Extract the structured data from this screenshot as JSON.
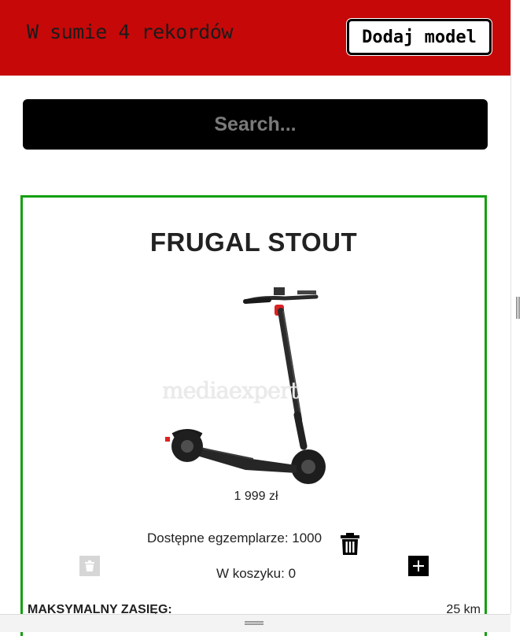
{
  "header": {
    "title": "W sumie 4 rekordów",
    "add_button_label": "Dodaj model"
  },
  "search": {
    "placeholder": "Search..."
  },
  "product": {
    "name": "FRUGAL STOUT",
    "watermark": "mediaexpert",
    "price": "1 999 zł",
    "available": "Dostępne egzemplarze: 1000",
    "cart": "W koszyku: 0",
    "spec_label": "MAKSYMALNY ZASIĘG:",
    "spec_value": "25 km"
  },
  "icons": {
    "delete_model": "trash-icon",
    "remove_from_cart": "trash-icon",
    "add_to_cart": "plus-icon"
  },
  "colors": {
    "header_bg": "#c60808",
    "card_border": "#13a00f",
    "search_bg": "#000000"
  }
}
